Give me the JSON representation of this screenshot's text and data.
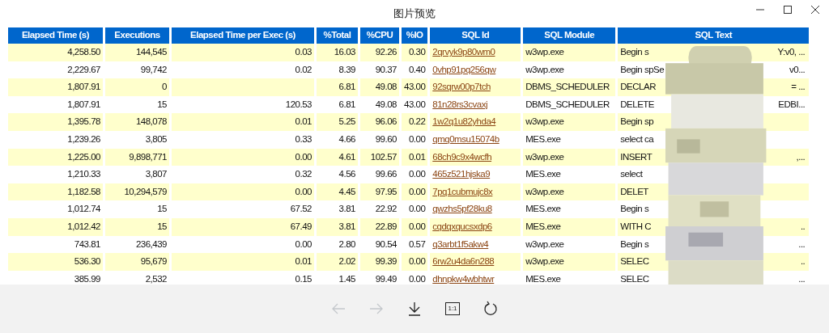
{
  "window": {
    "title": "图片预览"
  },
  "table": {
    "columns": [
      "Elapsed Time (s)",
      "Executions",
      "Elapsed Time per Exec (s)",
      "%Total",
      "%CPU",
      "%IO",
      "SQL Id",
      "SQL Module",
      "SQL Text"
    ],
    "rows": [
      {
        "elapsed": "4,258.50",
        "executions": "144,545",
        "per_exec": "0.03",
        "total": "16.03",
        "cpu": "92.26",
        "io": "0.30",
        "sql_id": "2qrvyk9p80wm0",
        "module": "w3wp.exe",
        "text_start": "Begin s",
        "text_end": "Y:v0, ..."
      },
      {
        "elapsed": "2,229.67",
        "executions": "99,742",
        "per_exec": "0.02",
        "total": "8.39",
        "cpu": "90.37",
        "io": "0.40",
        "sql_id": "0vhp91pq256qw",
        "module": "w3wp.exe",
        "text_start": "Begin spSe",
        "text_end": "v0..."
      },
      {
        "elapsed": "1,807.91",
        "executions": "0",
        "total": "6.81",
        "cpu": "49.08",
        "io": "43.00",
        "sql_id": "92sqrw00p7tch",
        "module": "DBMS_SCHEDULER",
        "text_start": "DECLAR",
        "text_end": "= ..."
      },
      {
        "elapsed": "1,807.91",
        "executions": "15",
        "per_exec": "120.53",
        "total": "6.81",
        "cpu": "49.08",
        "io": "43.00",
        "sql_id": "81n28rs3cvaxj",
        "module": "DBMS_SCHEDULER",
        "text_start": "DELETE",
        "text_end": "EDBI..."
      },
      {
        "elapsed": "1,395.78",
        "executions": "148,078",
        "per_exec": "0.01",
        "total": "5.25",
        "cpu": "96.06",
        "io": "0.22",
        "sql_id": "1w2q1u82yhda4",
        "module": "w3wp.exe",
        "text_start": "Begin sp"
      },
      {
        "elapsed": "1,239.26",
        "executions": "3,805",
        "per_exec": "0.33",
        "total": "4.66",
        "cpu": "99.60",
        "io": "0.00",
        "sql_id": "qmq0msu15074b",
        "module": "MES.exe",
        "text_start": "select ca"
      },
      {
        "elapsed": "1,225.00",
        "executions": "9,898,771",
        "per_exec": "0.00",
        "total": "4.61",
        "cpu": "102.57",
        "io": "0.01",
        "sql_id": "68ch9c9x4wcfh",
        "module": "w3wp.exe",
        "text_start": "INSERT",
        "text_end": ",..."
      },
      {
        "elapsed": "1,210.33",
        "executions": "3,807",
        "per_exec": "0.32",
        "total": "4.56",
        "cpu": "99.66",
        "io": "0.00",
        "sql_id": "465z521hjska9",
        "module": "MES.exe",
        "text_start": "select"
      },
      {
        "elapsed": "1,182.58",
        "executions": "10,294,579",
        "per_exec": "0.00",
        "total": "4.45",
        "cpu": "97.95",
        "io": "0.00",
        "sql_id": "7pq1cubmujc8x",
        "module": "w3wp.exe",
        "text_start": "DELET"
      },
      {
        "elapsed": "1,012.74",
        "executions": "15",
        "per_exec": "67.52",
        "total": "3.81",
        "cpu": "22.92",
        "io": "0.00",
        "sql_id": "qwzhs5pf28ku8",
        "module": "MES.exe",
        "text_start": "Begin s"
      },
      {
        "elapsed": "1,012.42",
        "executions": "15",
        "per_exec": "67.49",
        "total": "3.81",
        "cpu": "22.89",
        "io": "0.00",
        "sql_id": "cqdqxqucsxdp6",
        "module": "MES.exe",
        "text_start": "WITH C",
        "text_end": ".."
      },
      {
        "elapsed": "743.81",
        "executions": "236,439",
        "per_exec": "0.00",
        "total": "2.80",
        "cpu": "90.54",
        "io": "0.57",
        "sql_id": "q3arbt1f5akw4",
        "module": "w3wp.exe",
        "text_start": "Begin s",
        "text_end": "..."
      },
      {
        "elapsed": "536.30",
        "executions": "95,679",
        "per_exec": "0.01",
        "total": "2.02",
        "cpu": "99.39",
        "io": "0.00",
        "sql_id": "6rw2u4da6n288",
        "module": "w3wp.exe",
        "text_start": "SELEC",
        "text_end": ".."
      },
      {
        "elapsed": "385.99",
        "executions": "2,532",
        "per_exec": "0.15",
        "total": "1.45",
        "cpu": "99.49",
        "io": "0.00",
        "sql_id": "dhnpkw4wbhtwr",
        "module": "MES.exe",
        "text_start": "SELEC",
        "text_end": "..."
      }
    ]
  },
  "toolbar": [
    {
      "kind": "back",
      "disabled": true
    },
    {
      "kind": "forward",
      "disabled": true
    },
    {
      "kind": "download",
      "disabled": false
    },
    {
      "kind": "actual_size",
      "label": "1:1",
      "disabled": false
    },
    {
      "kind": "rotate",
      "disabled": false
    }
  ]
}
